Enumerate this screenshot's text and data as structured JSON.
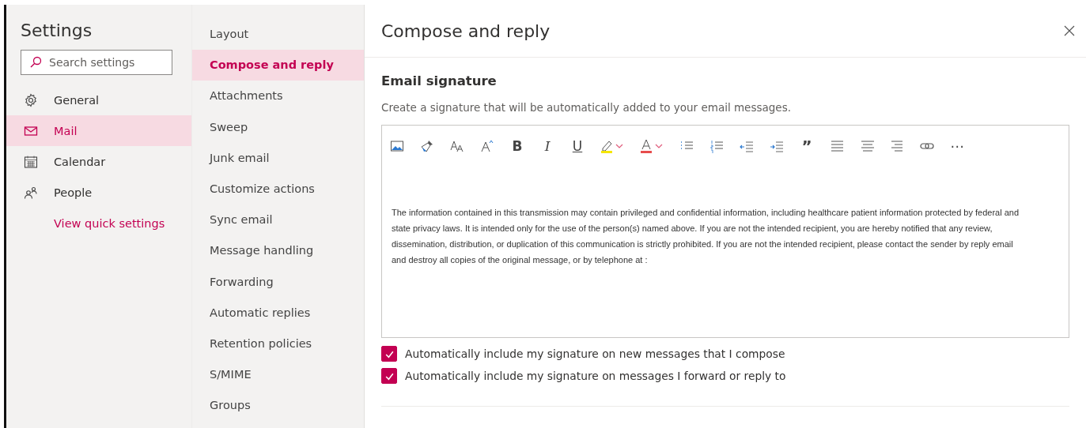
{
  "settings": {
    "title": "Settings",
    "search": {
      "placeholder": "Search settings"
    },
    "categories": [
      {
        "kind": "gear",
        "label": "General",
        "selected": false
      },
      {
        "kind": "mail",
        "label": "Mail",
        "selected": true
      },
      {
        "kind": "calendar",
        "label": "Calendar",
        "selected": false
      },
      {
        "kind": "people",
        "label": "People",
        "selected": false
      }
    ],
    "quick_link": "View quick settings"
  },
  "nav": [
    {
      "label": "Layout",
      "selected": false
    },
    {
      "label": "Compose and reply",
      "selected": true
    },
    {
      "label": "Attachments",
      "selected": false
    },
    {
      "label": "Sweep",
      "selected": false
    },
    {
      "label": "Junk email",
      "selected": false
    },
    {
      "label": "Customize actions",
      "selected": false
    },
    {
      "label": "Sync email",
      "selected": false
    },
    {
      "label": "Message handling",
      "selected": false
    },
    {
      "label": "Forwarding",
      "selected": false
    },
    {
      "label": "Automatic replies",
      "selected": false
    },
    {
      "label": "Retention policies",
      "selected": false
    },
    {
      "label": "S/MIME",
      "selected": false
    },
    {
      "label": "Groups",
      "selected": false
    }
  ],
  "panel": {
    "title": "Compose and reply",
    "section": "Email signature",
    "description": "Create a signature that will be automatically added to your email messages.",
    "toolbar": [
      {
        "kind": "image"
      },
      {
        "kind": "brush"
      },
      {
        "kind": "size"
      },
      {
        "kind": "grow"
      },
      {
        "kind": "bold",
        "label": "B"
      },
      {
        "kind": "italic",
        "label": "I"
      },
      {
        "kind": "underline",
        "label": "U"
      },
      {
        "kind": "highlight"
      },
      {
        "kind": "fontcolor"
      },
      {
        "kind": "bullets"
      },
      {
        "kind": "numbers"
      },
      {
        "kind": "outdent"
      },
      {
        "kind": "indent"
      },
      {
        "kind": "quote",
        "label": "”"
      },
      {
        "kind": "alignleft"
      },
      {
        "kind": "aligncenter"
      },
      {
        "kind": "alignright"
      },
      {
        "kind": "link"
      },
      {
        "kind": "more",
        "label": "⋯"
      }
    ],
    "signature": "The information contained in this transmission may contain privileged and confidential information, including healthcare patient information protected by federal and\nstate privacy laws. It is intended only for the use of the person(s) named above. If you are not the intended recipient, you are hereby notified that any review,\ndissemination, distribution, or duplication of this communication is strictly prohibited. If you are not the intended recipient, please contact the sender by reply email\nand destroy all copies of the original message, or by telephone at :",
    "options": [
      {
        "label": "Automatically include my signature on new messages that I compose",
        "checked": true
      },
      {
        "label": "Automatically include my signature on messages I forward or reply to",
        "checked": true
      }
    ]
  }
}
